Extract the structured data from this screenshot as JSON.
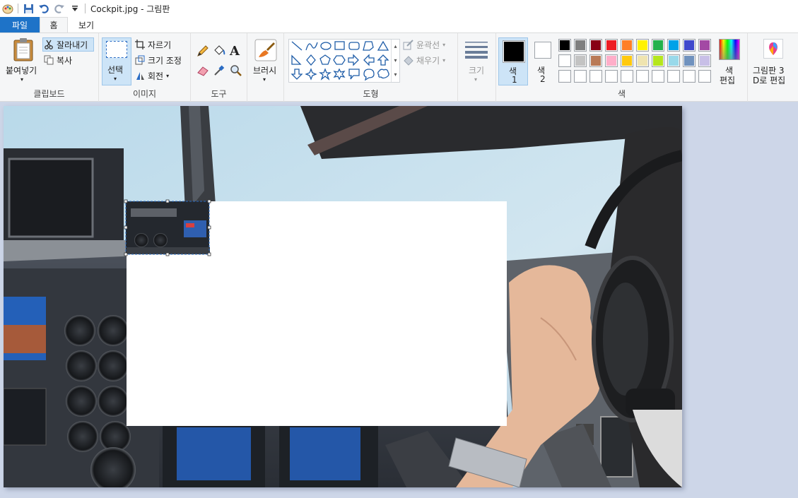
{
  "titlebar": {
    "title": "Cockpit.jpg - 그림판"
  },
  "tabs": {
    "file": "파일",
    "home": "홈",
    "view": "보기"
  },
  "clipboard": {
    "paste": "붙여넣기",
    "cut": "잘라내기",
    "copy": "복사",
    "label": "클립보드"
  },
  "image": {
    "select": "선택",
    "crop": "자르기",
    "resize": "크기 조정",
    "rotate": "회전",
    "label": "이미지"
  },
  "tools": {
    "label": "도구",
    "text_glyph": "A"
  },
  "brushes": {
    "label": "브러시"
  },
  "shapes": {
    "outline": "윤곽선",
    "fill": "채우기",
    "label": "도형"
  },
  "size": {
    "label": "크기"
  },
  "colors": {
    "color1_line1": "색",
    "color1_line2": "1",
    "color2_line1": "색",
    "color2_line2": "2",
    "edit_line1": "색",
    "edit_line2": "편집",
    "label": "색",
    "color1_value": "#000000",
    "color2_value": "#ffffff",
    "palette": [
      "#000000",
      "#7f7f7f",
      "#880015",
      "#ed1c24",
      "#ff7f27",
      "#fff200",
      "#22b14c",
      "#00a2e8",
      "#3f48cc",
      "#a349a4",
      "#ffffff",
      "#c3c3c3",
      "#b97a57",
      "#ffaec9",
      "#ffc90e",
      "#efe4b0",
      "#b5e61d",
      "#99d9ea",
      "#7092be",
      "#c8bfe7",
      "#ffffff",
      "#ffffff",
      "#ffffff",
      "#ffffff",
      "#ffffff",
      "#ffffff",
      "#ffffff",
      "#ffffff",
      "#ffffff",
      "#ffffff"
    ]
  },
  "paint3d": {
    "line1": "그림판 3",
    "line2": "D로 편집"
  }
}
